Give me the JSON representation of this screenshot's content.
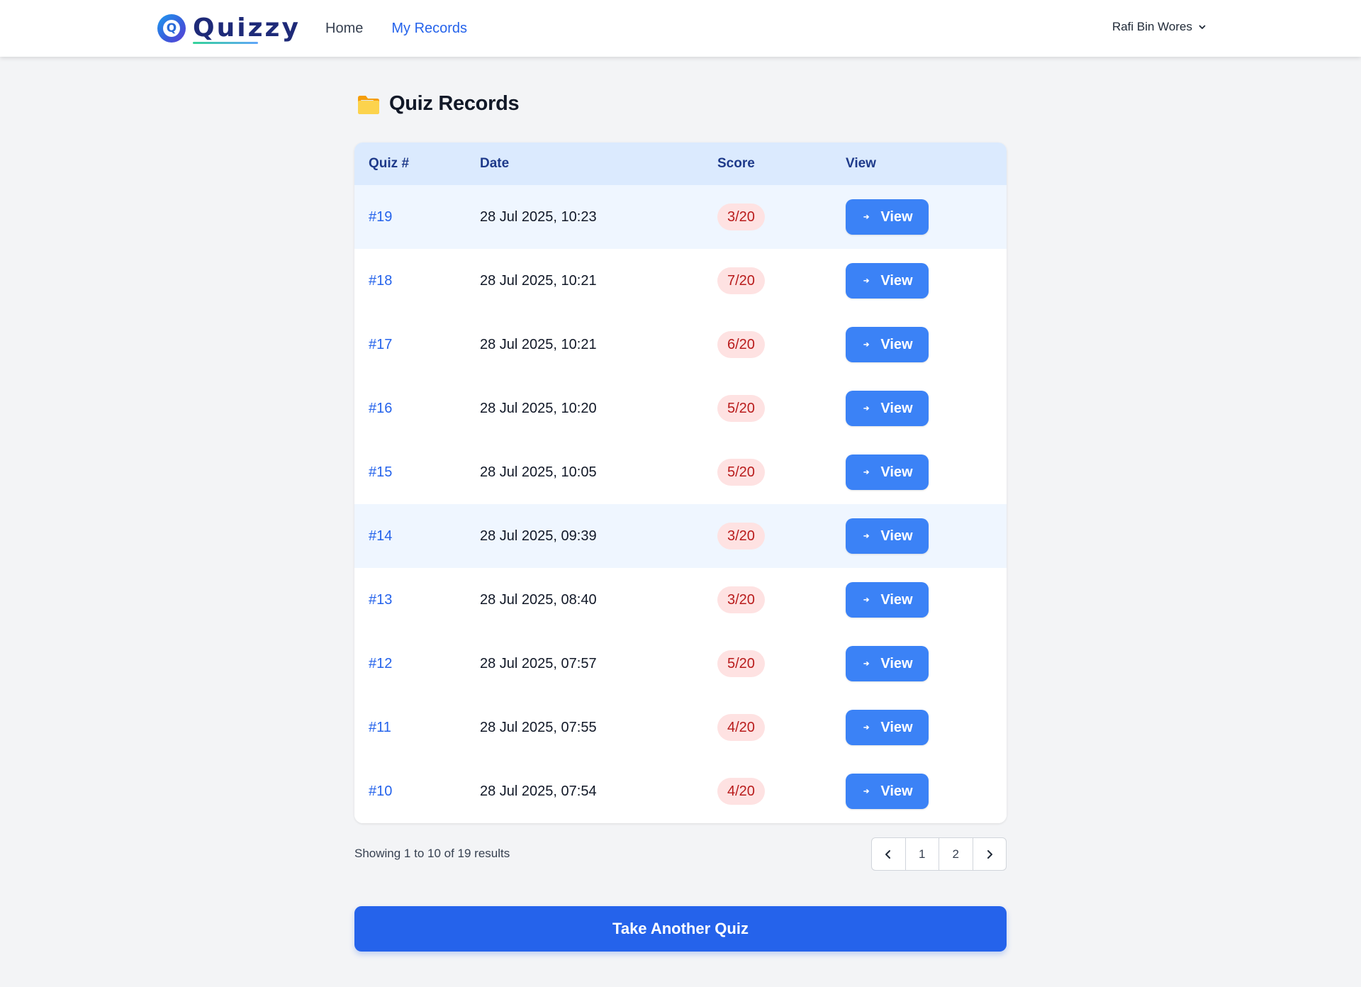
{
  "brand": {
    "name": "Quizzy",
    "logo_letter": "Q"
  },
  "nav": {
    "items": [
      {
        "label": "Home",
        "active": false
      },
      {
        "label": "My Records",
        "active": true
      }
    ]
  },
  "user": {
    "name": "Rafi Bin Wores",
    "icon": "chevron-down-icon"
  },
  "page": {
    "title": "Quiz Records",
    "title_icon": "folder-icon"
  },
  "table": {
    "headers": [
      "Quiz #",
      "Date",
      "Score",
      "View"
    ],
    "rows": [
      {
        "quiz": "#19",
        "date": "28 Jul 2025, 10:23",
        "score": "3/20",
        "action": "View",
        "highlight": true
      },
      {
        "quiz": "#18",
        "date": "28 Jul 2025, 10:21",
        "score": "7/20",
        "action": "View",
        "highlight": false
      },
      {
        "quiz": "#17",
        "date": "28 Jul 2025, 10:21",
        "score": "6/20",
        "action": "View",
        "highlight": false
      },
      {
        "quiz": "#16",
        "date": "28 Jul 2025, 10:20",
        "score": "5/20",
        "action": "View",
        "highlight": false
      },
      {
        "quiz": "#15",
        "date": "28 Jul 2025, 10:05",
        "score": "5/20",
        "action": "View",
        "highlight": false
      },
      {
        "quiz": "#14",
        "date": "28 Jul 2025, 09:39",
        "score": "3/20",
        "action": "View",
        "highlight": true
      },
      {
        "quiz": "#13",
        "date": "28 Jul 2025, 08:40",
        "score": "3/20",
        "action": "View",
        "highlight": false
      },
      {
        "quiz": "#12",
        "date": "28 Jul 2025, 07:57",
        "score": "5/20",
        "action": "View",
        "highlight": false
      },
      {
        "quiz": "#11",
        "date": "28 Jul 2025, 07:55",
        "score": "4/20",
        "action": "View",
        "highlight": false
      },
      {
        "quiz": "#10",
        "date": "28 Jul 2025, 07:54",
        "score": "4/20",
        "action": "View",
        "highlight": false
      }
    ]
  },
  "pagination": {
    "summary": "Showing 1 to 10 of 19 results",
    "prev_icon": "chevron-left-icon",
    "pages": [
      "1",
      "2"
    ],
    "next_icon": "chevron-right-icon"
  },
  "cta": {
    "label": "Take Another Quiz"
  },
  "colors": {
    "accent": "#2563eb",
    "button": "#3b82f6",
    "header_bg": "#dbeafe",
    "row_highlight": "#eff6ff",
    "score_badge_bg": "#fee2e2",
    "score_badge_text": "#b91c1c",
    "page_bg": "#f3f4f6"
  }
}
